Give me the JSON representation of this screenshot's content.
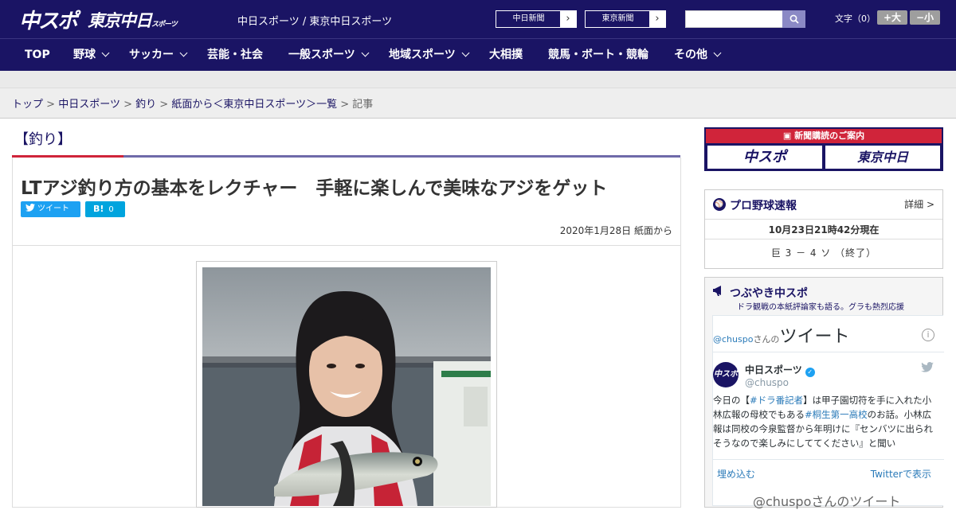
{
  "header": {
    "logo_chuspo": "中スポ",
    "logo_tokyo": "東京中日",
    "logo_tokyo_small": "スポーツ",
    "site_title": "中日スポーツ / 東京中日スポーツ",
    "paper_links": [
      "中日新聞",
      "東京新聞"
    ],
    "search_placeholder": "",
    "fontsize_label": "文字（0）",
    "fontsize_up": "+大",
    "fontsize_down": "−小"
  },
  "nav": {
    "items": [
      "TOP",
      "野球",
      "サッカー",
      "芸能・社会",
      "一般スポーツ",
      "地域スポーツ",
      "大相撲",
      "競馬・ボート・競輪",
      "その他"
    ]
  },
  "breadcrumb": {
    "items": [
      "トップ",
      "中日スポーツ",
      "釣り",
      "紙面から＜東京中日スポーツ＞一覧"
    ],
    "current": "記事",
    "separator": ">"
  },
  "section": {
    "title": "【釣り】"
  },
  "article": {
    "title": "LTアジ釣り方の基本をレクチャー　手軽に楽しんで美味なアジをゲット",
    "tweet_label": "ツイート",
    "hatena_label": "B!",
    "hatena_count": "0",
    "date": "2020年1月28日 紙面から"
  },
  "sidebar": {
    "subscribe": {
      "heading": "新聞購読のご案内",
      "buttons": [
        "中スポ",
        "東京中日"
      ]
    },
    "baseball": {
      "title": "プロ野球速報",
      "detail": "詳細 >",
      "time": "10月23日21時42分現在",
      "score": "巨 3 － 4 ソ （終了）"
    },
    "tsubuyaki": {
      "title": "つぶやき中スポ",
      "subtitle": "ドラ観戦の本紙評論家も語る。グラも熱烈応援"
    },
    "twitter": {
      "handle": "@chuspo",
      "header_suffix": "さんの",
      "header_big": "ツイート",
      "name": "中日スポーツ",
      "user_handle": "@chuspo",
      "tweet_parts": {
        "p1": "今日の【",
        "hashtag1": "#ドラ番記者",
        "p2": "】は甲子園切符を手に入れた小林広報の母校でもある",
        "hashtag2": "#桐生第一高校",
        "p3": "のお話。小林広報は同校の今泉監督から年明けに『センバツに出られそうなので楽しみにしててください』と聞い"
      },
      "embed": "埋め込む",
      "view": "Twitterで表示",
      "next_header": "@chuspoさんのツイート"
    }
  }
}
